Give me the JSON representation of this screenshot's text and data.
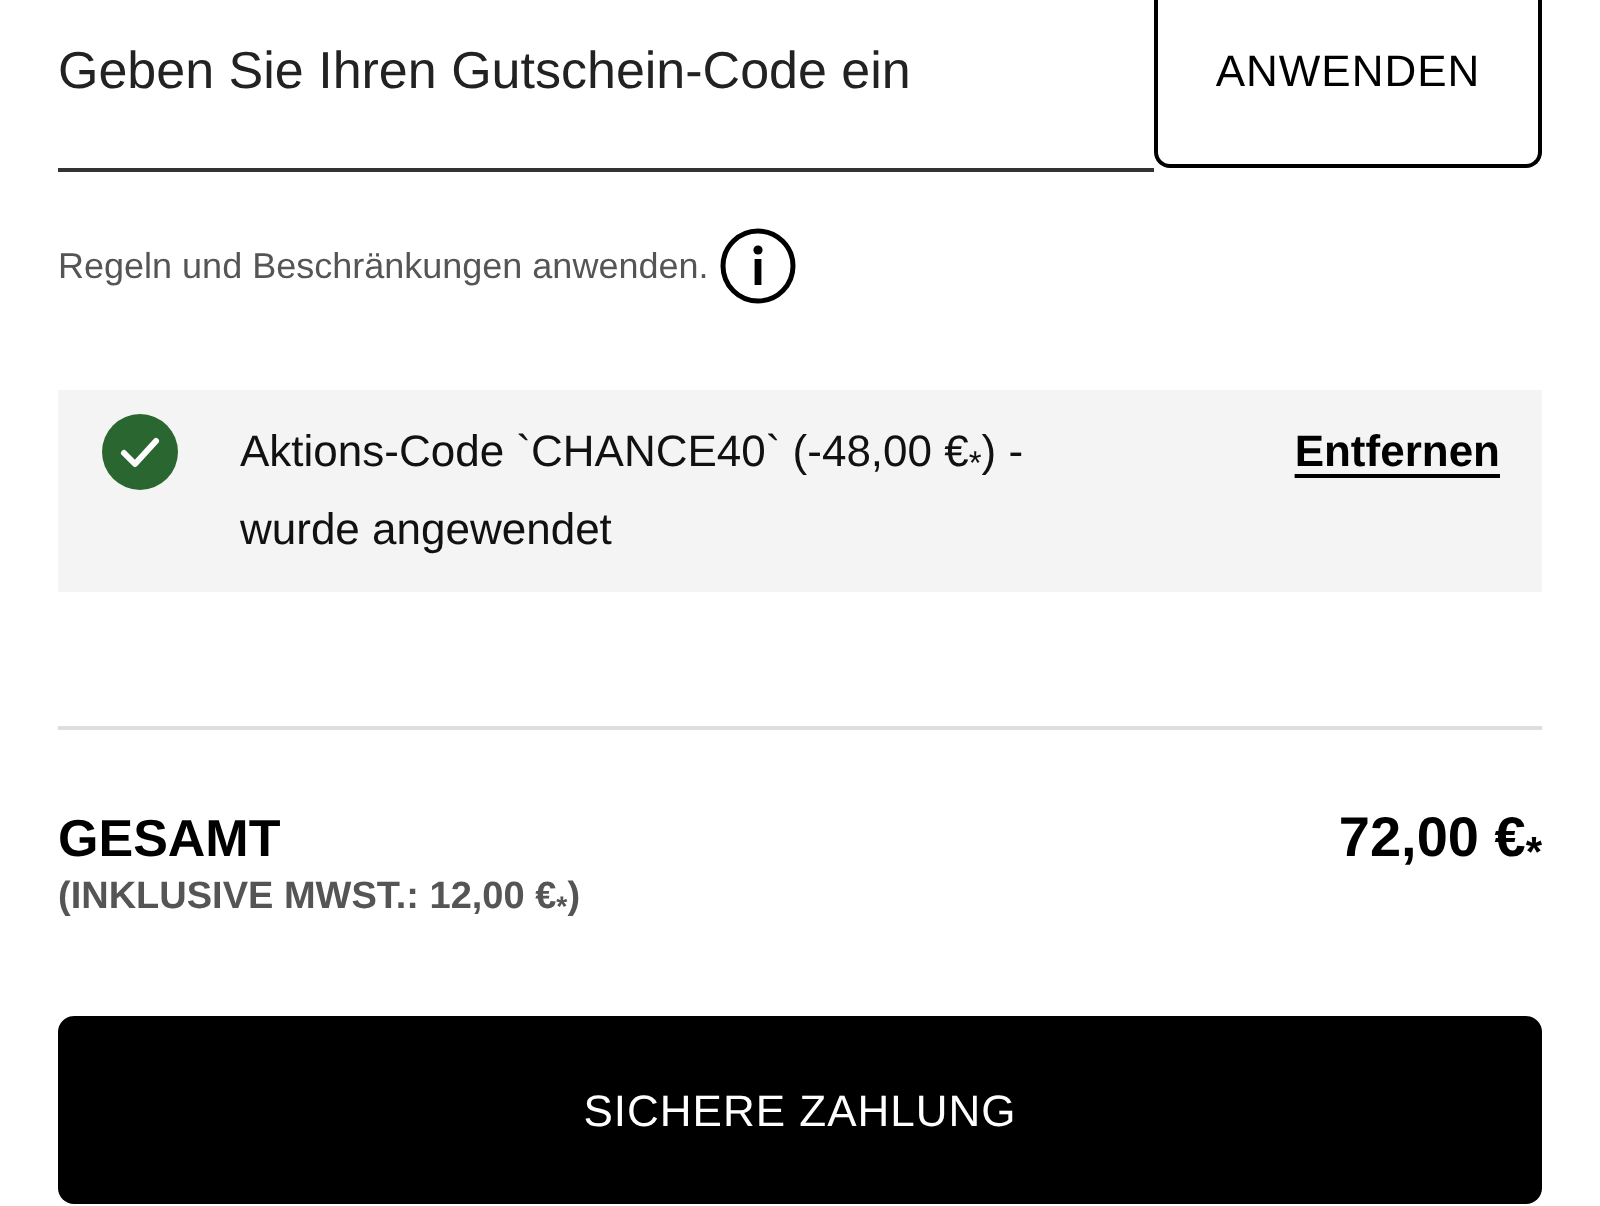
{
  "coupon": {
    "placeholder": "Geben Sie Ihren Gutschein-Code ein",
    "apply_button": "ANWENDEN"
  },
  "rules_note": "Regeln und Beschränkungen anwenden.",
  "applied_code": {
    "message": "Aktions-Code `CHANCE40` (-48,00 €$_{*}$) - wurde angewendet",
    "remove_link": "Entfernen"
  },
  "total": {
    "label": "GESAMT",
    "tax_note": "(INKLUSIVE MWST.: 12,00 €$_{*}$)",
    "amount": "72,00 €$_{*}$"
  },
  "checkout_button": "SICHERE ZAHLUNG"
}
